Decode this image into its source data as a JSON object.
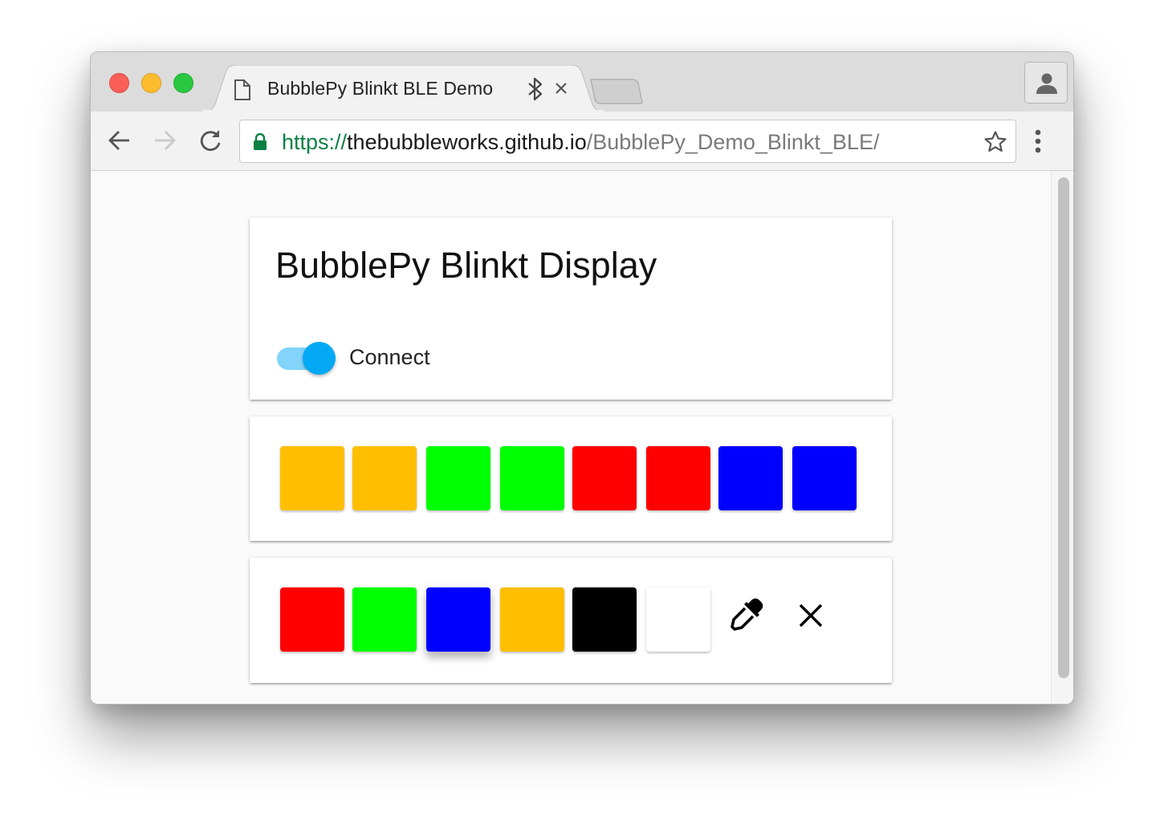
{
  "browser": {
    "tab": {
      "title": "BubblePy Blinkt BLE Demo",
      "icons": [
        "document-icon",
        "bluetooth-icon",
        "close-icon"
      ]
    },
    "url": {
      "scheme": "https://",
      "host": "thebubbleworks.github.io",
      "path": "/BubblePy_Demo_Blinkt_BLE/"
    },
    "nav_icons": [
      "back-arrow-icon",
      "forward-arrow-icon",
      "reload-icon",
      "lock-icon",
      "star-icon",
      "more-vert-icon",
      "profile-icon"
    ],
    "forward_enabled": false
  },
  "page": {
    "title": "BubblePy Blinkt Display",
    "connect": {
      "label": "Connect",
      "on": true,
      "accent_color": "#03a9f4"
    },
    "leds": [
      {
        "color": "#ffbf00"
      },
      {
        "color": "#ffbf00"
      },
      {
        "color": "#00ff00"
      },
      {
        "color": "#00ff00"
      },
      {
        "color": "#ff0000"
      },
      {
        "color": "#ff0000"
      },
      {
        "color": "#0000ff"
      },
      {
        "color": "#0000ff"
      }
    ],
    "palette": [
      {
        "color": "#ff0000",
        "selected": false
      },
      {
        "color": "#00ff00",
        "selected": false
      },
      {
        "color": "#0000ff",
        "selected": true
      },
      {
        "color": "#ffbf00",
        "selected": false
      },
      {
        "color": "#000000",
        "selected": false
      },
      {
        "color": "#ffffff",
        "selected": false
      }
    ],
    "tools": [
      "eyedropper-icon",
      "clear-icon"
    ]
  }
}
